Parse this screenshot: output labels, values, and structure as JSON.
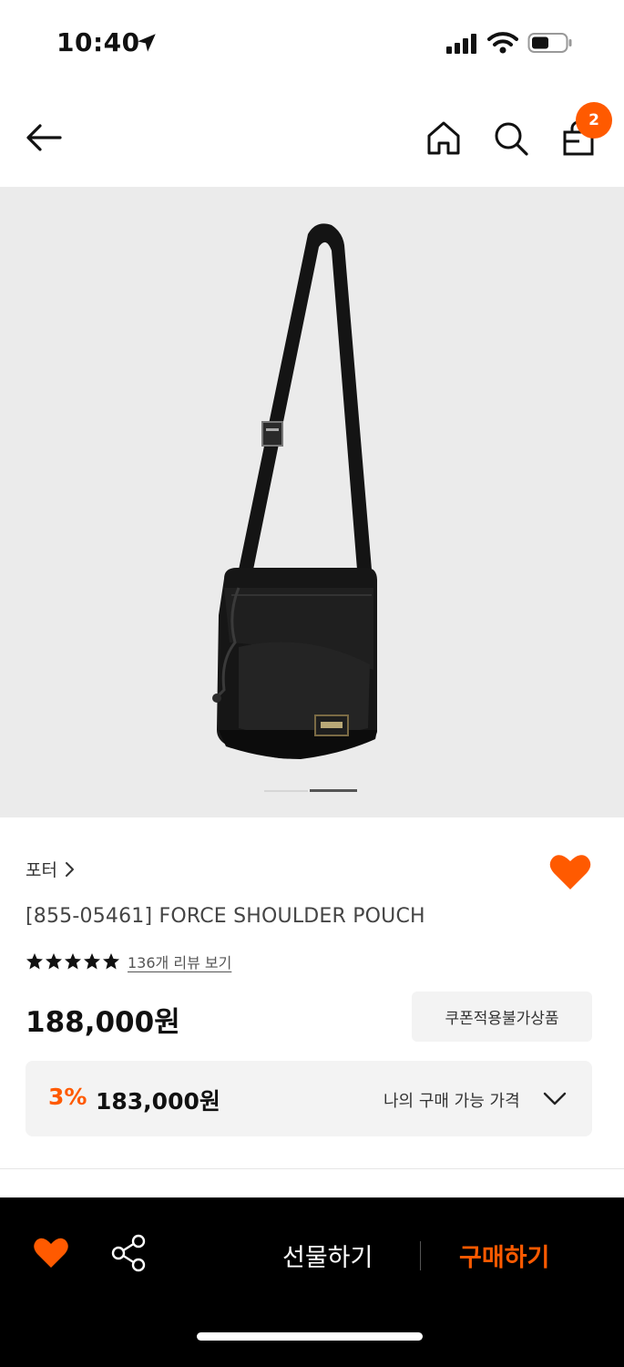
{
  "status_bar": {
    "time": "10:40",
    "icons": [
      "location-arrow-icon",
      "signal-icon",
      "wifi-icon",
      "battery-icon"
    ]
  },
  "top_nav": {
    "icons": [
      "back-arrow-icon",
      "home-icon",
      "search-icon",
      "shopping-bag-icon"
    ],
    "cart_count": "2"
  },
  "product": {
    "brand": "포터",
    "name": "[855-05461] FORCE SHOULDER POUCH",
    "review_link": "136개 리뷰 보기",
    "rating_stars": 5,
    "price": "188,000원",
    "coupon_notice": "쿠폰적용불가상품",
    "my_price": {
      "discount": "3%",
      "price": "183,000원",
      "label": "나의 구매 가능 가격"
    }
  },
  "bottom_bar": {
    "gift_label": "선물하기",
    "buy_label": "구매하기"
  },
  "colors": {
    "accent": "#ff5a00",
    "bottom_bar_bg": "#000000",
    "image_bg": "#ebebeb"
  }
}
